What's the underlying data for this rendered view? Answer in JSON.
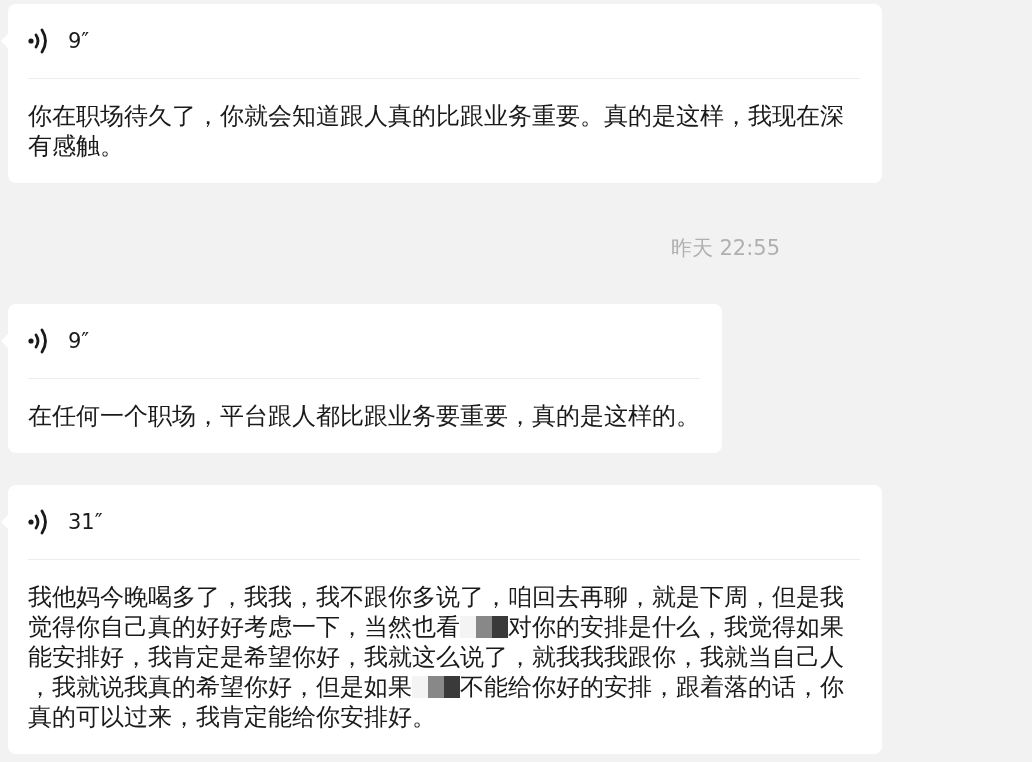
{
  "messages": [
    {
      "kind": "voice",
      "duration": "9″",
      "transcript": [
        {
          "kind": "text",
          "text": "你在职场待久了，你就会知道跟人真的比跟业务重要。真的是这样，我现在深有感触。"
        }
      ]
    },
    {
      "kind": "timestamp",
      "text": "昨天 22:55"
    },
    {
      "kind": "voice",
      "duration": "9″",
      "transcript": [
        {
          "kind": "text",
          "text": "在任何一个职场，平台跟人都比跟业务要重要，真的是这样的。"
        }
      ]
    },
    {
      "kind": "voice",
      "duration": "31″",
      "transcript": [
        {
          "kind": "text",
          "text": "我他妈今晚喝多了，我我，我不跟你多说了，咱回去再聊，就是下周，但是我觉得你自己真的好好考虑一下，当然也看"
        },
        {
          "kind": "redaction"
        },
        {
          "kind": "text",
          "text": "对你的安排是什么，我觉得如果能安排好，我肯定是希望你好，我就这么说了，就我我我跟你，我就当自己人，我就说我真的希望你好，但是如果"
        },
        {
          "kind": "redaction"
        },
        {
          "kind": "text",
          "text": "不能给你好的安排，跟着落的话，你真的可以过来，我肯定能给你安排好。"
        }
      ]
    }
  ]
}
